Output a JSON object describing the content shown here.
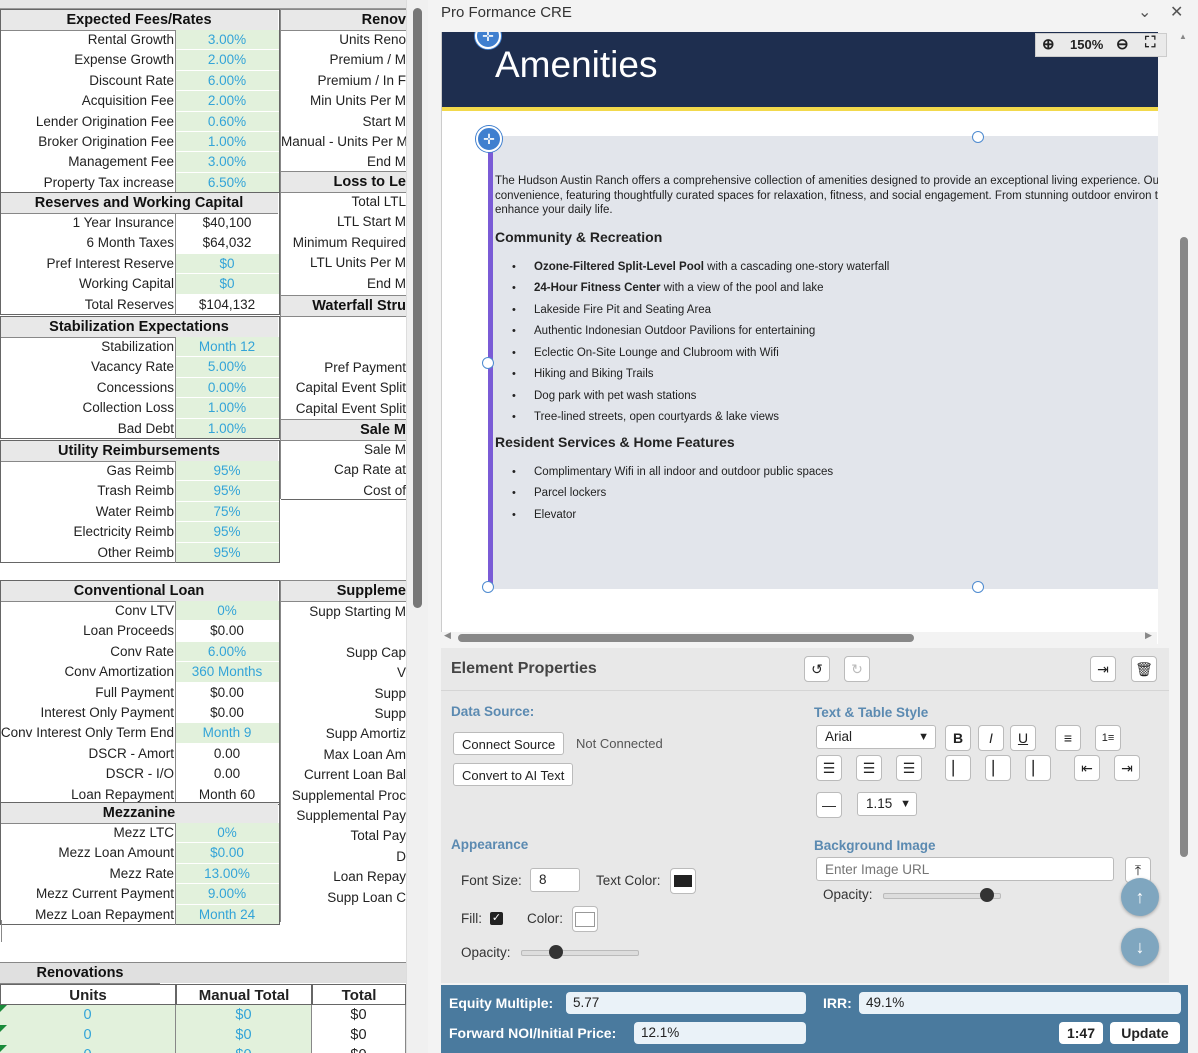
{
  "sheet": {
    "expected_fees": {
      "title": "Expected Fees/Rates",
      "rows": [
        {
          "label": "Rental Growth",
          "value": "3.00%",
          "kind": "input"
        },
        {
          "label": "Expense Growth",
          "value": "2.00%",
          "kind": "input"
        },
        {
          "label": "Discount Rate",
          "value": "6.00%",
          "kind": "input"
        },
        {
          "label": "Acquisition Fee",
          "value": "2.00%",
          "kind": "input"
        },
        {
          "label": "Lender Origination Fee",
          "value": "0.60%",
          "kind": "input"
        },
        {
          "label": "Broker Origination Fee",
          "value": "1.00%",
          "kind": "input"
        },
        {
          "label": "Management Fee",
          "value": "3.00%",
          "kind": "input"
        },
        {
          "label": "Property Tax increase",
          "value": "6.50%",
          "kind": "input"
        }
      ]
    },
    "reserves": {
      "title": "Reserves and Working Capital",
      "rows": [
        {
          "label": "1 Year Insurance",
          "value": "$40,100",
          "kind": "calc"
        },
        {
          "label": "6 Month Taxes",
          "value": "$64,032",
          "kind": "calc"
        },
        {
          "label": "Pref Interest Reserve",
          "value": "$0",
          "kind": "input"
        },
        {
          "label": "Working Capital",
          "value": "$0",
          "kind": "input"
        },
        {
          "label": "Total Reserves",
          "value": "$104,132",
          "kind": "calc"
        }
      ]
    },
    "stabilization": {
      "title": "Stabilization Expectations",
      "rows": [
        {
          "label": "Stabilization",
          "value": "Month 12",
          "kind": "input"
        },
        {
          "label": "Vacancy Rate",
          "value": "5.00%",
          "kind": "input"
        },
        {
          "label": "Concessions",
          "value": "0.00%",
          "kind": "input"
        },
        {
          "label": "Collection Loss",
          "value": "1.00%",
          "kind": "input"
        },
        {
          "label": "Bad Debt",
          "value": "1.00%",
          "kind": "input"
        }
      ]
    },
    "utility": {
      "title": "Utility Reimbursements",
      "rows": [
        {
          "label": "Gas Reimb",
          "value": "95%",
          "kind": "input"
        },
        {
          "label": "Trash Reimb",
          "value": "95%",
          "kind": "input"
        },
        {
          "label": "Water Reimb",
          "value": "75%",
          "kind": "input"
        },
        {
          "label": "Electricity Reimb",
          "value": "95%",
          "kind": "input"
        },
        {
          "label": "Other Reimb",
          "value": "95%",
          "kind": "input"
        }
      ]
    },
    "conventional": {
      "title": "Conventional Loan",
      "rows": [
        {
          "label": "Conv LTV",
          "value": "0%",
          "kind": "input"
        },
        {
          "label": "Loan Proceeds",
          "value": "$0.00",
          "kind": "calc"
        },
        {
          "label": "Conv Rate",
          "value": "6.00%",
          "kind": "input"
        },
        {
          "label": "Conv Amortization",
          "value": "360 Months",
          "kind": "input"
        },
        {
          "label": "Full Payment",
          "value": "$0.00",
          "kind": "calc"
        },
        {
          "label": "Interest Only Payment",
          "value": "$0.00",
          "kind": "calc"
        },
        {
          "label": "Conv Interest Only Term End",
          "value": "Month 9",
          "kind": "input"
        },
        {
          "label": "DSCR - Amort",
          "value": "0.00",
          "kind": "calc"
        },
        {
          "label": "DSCR - I/O",
          "value": "0.00",
          "kind": "calc"
        },
        {
          "label": "Loan Repayment",
          "value": "Month 60",
          "kind": "calc"
        }
      ]
    },
    "mezzanine": {
      "title": "Mezzanine",
      "rows": [
        {
          "label": "Mezz LTC",
          "value": "0%",
          "kind": "input"
        },
        {
          "label": "Mezz Loan Amount",
          "value": "$0.00",
          "kind": "input"
        },
        {
          "label": "Mezz Rate",
          "value": "13.00%",
          "kind": "input"
        },
        {
          "label": "Mezz Current Payment",
          "value": "9.00%",
          "kind": "input"
        },
        {
          "label": "Mezz Loan Repayment",
          "value": "Month 24",
          "kind": "input"
        }
      ]
    },
    "right_col": {
      "renov_title": "Renov",
      "renov_rows": [
        "Units Reno",
        "Premium / M",
        "Premium / In F",
        "Min Units Per M",
        "Start M",
        "Manual - Units Per M",
        "End M"
      ],
      "ltl_title": "Loss to Le",
      "ltl_rows": [
        "Total LTL",
        "LTL Start M",
        "Minimum Required",
        "LTL Units Per M",
        "End M"
      ],
      "waterfall_title": "Waterfall Stru",
      "waterfall_rows": [
        "Pref Payment",
        "Capital Event Split",
        "Capital Event Split"
      ],
      "sale_title": "Sale M",
      "sale_rows": [
        "Sale M",
        "Cap Rate at",
        "Cost of"
      ],
      "supp_title": "Suppleme",
      "supp_rows": [
        "Supp Starting M",
        "",
        "Supp Cap",
        "V",
        "Supp",
        "Supp",
        "Supp Amortiz",
        "Max Loan Am",
        "Current Loan Bal",
        "Supplemental Proc",
        "Supplemental Pay",
        "Total Pay",
        "D",
        "Loan Repay",
        "Supp Loan C"
      ]
    },
    "renovations": {
      "title": "Renovations",
      "headers": [
        "Units",
        "Manual Total",
        "Total"
      ],
      "rows": [
        [
          "0",
          "$0",
          "$0"
        ],
        [
          "0",
          "$0",
          "$0"
        ],
        [
          "0",
          "$0",
          "$0"
        ]
      ]
    }
  },
  "panel": {
    "title": "Pro Formance CRE",
    "zoom": "150%",
    "slide": {
      "banner_title": "Amenities",
      "intro": "The Hudson Austin Ranch offers a comprehensive collection of amenities designed to provide an exceptional living experience. Our convenience, featuring thoughtfully curated spaces for relaxation, fitness, and social engagement. From stunning outdoor environ to enhance your daily life.",
      "heading1": "Community & Recreation",
      "list1": [
        {
          "bold": "Ozone-Filtered Split-Level Pool",
          "rest": " with a cascading one-story waterfall"
        },
        {
          "bold": "24-Hour Fitness Center",
          "rest": " with a view of the pool and lake"
        },
        {
          "bold": "",
          "rest": "Lakeside Fire Pit and Seating Area"
        },
        {
          "bold": "",
          "rest": "Authentic Indonesian Outdoor Pavilions for entertaining"
        },
        {
          "bold": "",
          "rest": "Eclectic On-Site Lounge and Clubroom with Wifi"
        },
        {
          "bold": "",
          "rest": "Hiking and Biking Trails"
        },
        {
          "bold": "",
          "rest": "Dog park with pet wash stations"
        },
        {
          "bold": "",
          "rest": "Tree-lined streets, open courtyards & lake views"
        }
      ],
      "heading2": "Resident Services & Home Features",
      "list2": [
        {
          "bold": "",
          "rest": "Complimentary Wifi in all indoor and outdoor public spaces"
        },
        {
          "bold": "",
          "rest": "Parcel lockers"
        },
        {
          "bold": "",
          "rest": "Elevator"
        }
      ]
    },
    "properties": {
      "title": "Element Properties",
      "data_source_label": "Data Source:",
      "connect_source": "Connect Source",
      "not_connected": "Not Connected",
      "convert_ai": "Convert to AI Text",
      "text_table_style": "Text & Table Style",
      "font_family": "Arial",
      "line_height": "1.15",
      "appearance_label": "Appearance",
      "font_size_label": "Font Size:",
      "font_size_value": "8",
      "text_color_label": "Text Color:",
      "text_color": "#222222",
      "fill_label": "Fill:",
      "color_label": "Color:",
      "fill_color": "#ffffff",
      "opacity_label": "Opacity:",
      "opacity_value": 0.3,
      "bg_image_label": "Background Image",
      "image_url_placeholder": "Enter Image URL",
      "bg_opacity_label": "Opacity:",
      "bg_opacity_value": 0.9
    },
    "footer": {
      "equity_label": "Equity Multiple:",
      "equity_value": "5.77",
      "irr_label": "IRR:",
      "irr_value": "49.1%",
      "noi_label": "Forward NOI/Initial Price:",
      "noi_value": "12.1%",
      "time": "1:47",
      "update_label": "Update"
    }
  }
}
